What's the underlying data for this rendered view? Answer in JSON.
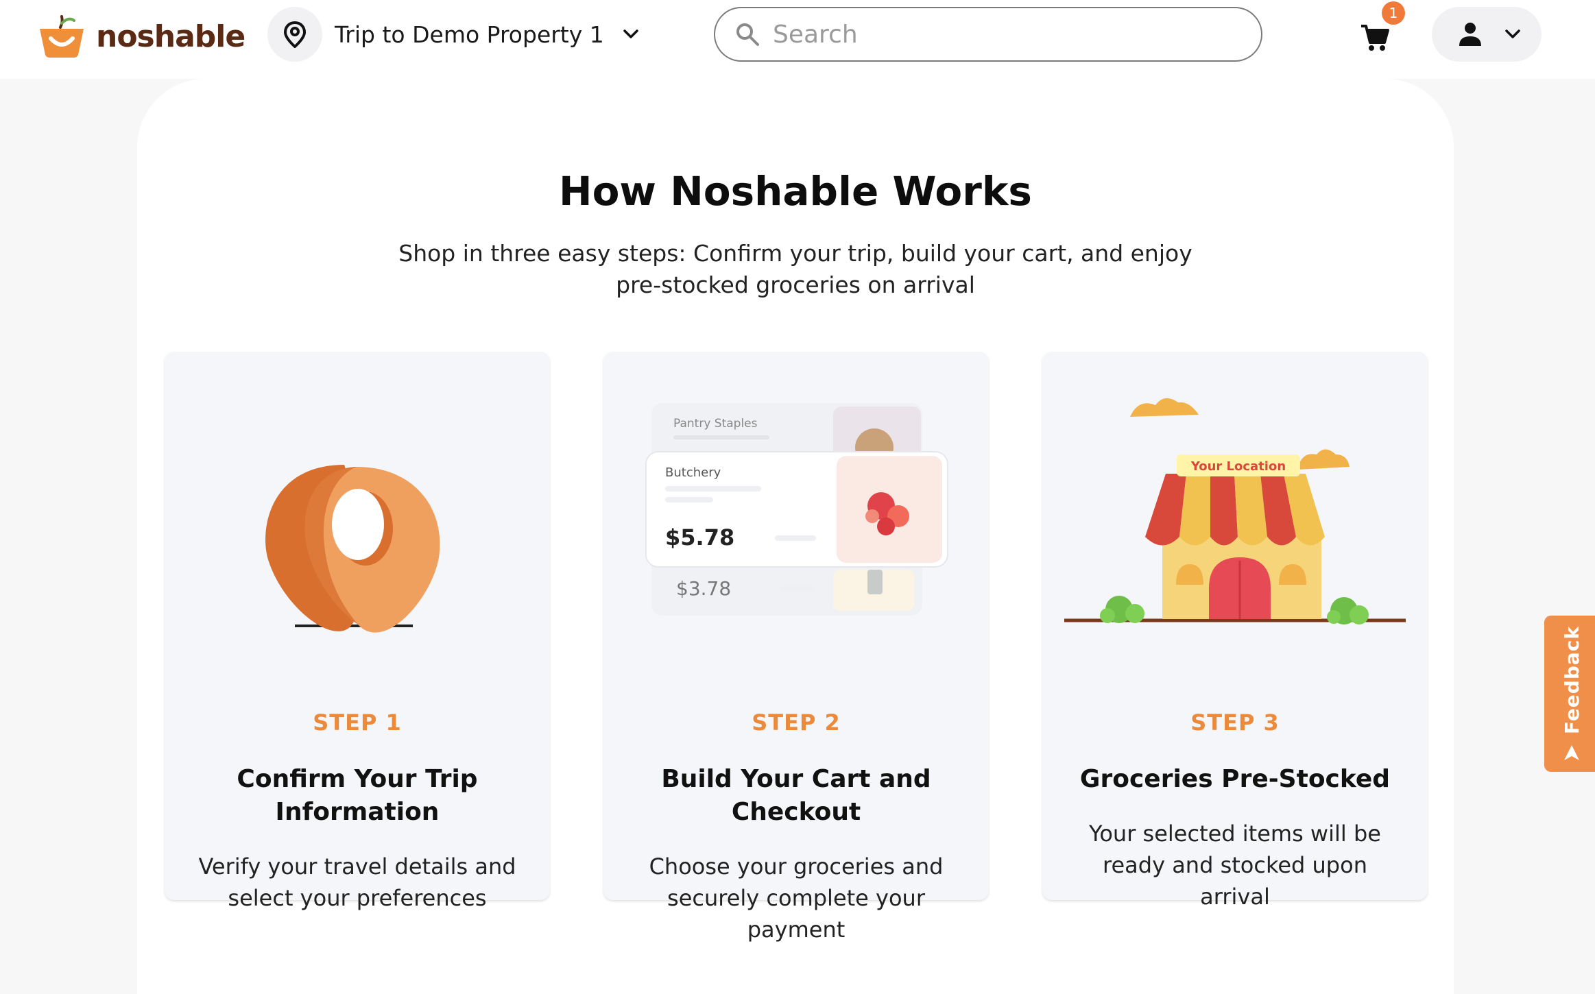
{
  "header": {
    "logo_text": "noshable",
    "trip_label": "Trip to Demo Property 1",
    "search_placeholder": "Search",
    "cart_count": "1"
  },
  "main": {
    "title": "How Noshable Works",
    "subtitle": "Shop in three easy steps: Confirm your trip, build your cart, and enjoy pre-stocked groceries on arrival",
    "steps": [
      {
        "step": "STEP 1",
        "title": "Confirm Your Trip Information",
        "description": "Verify your travel details and select your preferences"
      },
      {
        "step": "STEP 2",
        "title": "Build Your Cart and Checkout",
        "description": "Choose your groceries and securely complete your payment",
        "illustration": {
          "back_card_label": "Pantry Staples",
          "front_card_label": "Butchery",
          "front_price": "$5.78",
          "back_price": "$3.78"
        }
      },
      {
        "step": "STEP 3",
        "title": "Groceries Pre-Stocked",
        "description": "Your selected items will be ready and stocked upon arrival",
        "illustration": {
          "store_sign": "Your Location"
        }
      }
    ]
  },
  "feedback_label": "Feedback",
  "colors": {
    "accent": "#ec8a3a",
    "brand_text": "#5b2a14",
    "badge": "#f07a3a"
  }
}
